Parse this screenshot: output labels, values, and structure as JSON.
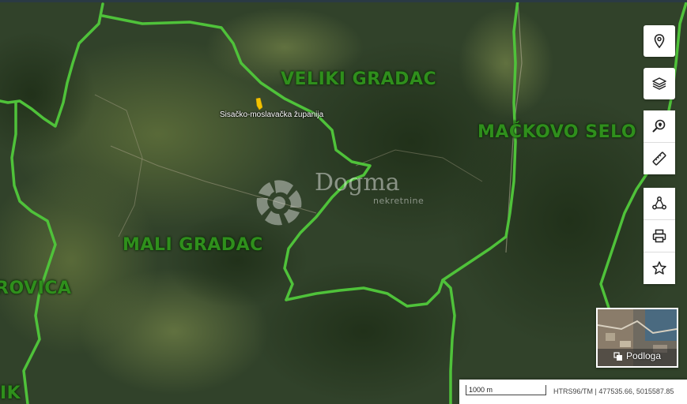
{
  "map": {
    "regions": [
      {
        "name": "VELIKI GRADAC"
      },
      {
        "name": "MAČKOVO SELO"
      },
      {
        "name": "MALI GRADAC"
      },
      {
        "name": "ROVICA"
      },
      {
        "name": "IK"
      }
    ],
    "county_label": "Sisačko-moslavačka županija",
    "watermark": {
      "brand": "Dogma",
      "tagline": "nekretnine"
    },
    "boundary_color": "#4fc23a",
    "parcel_color": "#f2c200"
  },
  "toolbar": {
    "buttons": [
      {
        "id": "location",
        "icon": "location-pin-icon"
      },
      {
        "id": "layers",
        "icon": "layers-icon"
      },
      {
        "id": "search-location",
        "icon": "search-location-icon"
      },
      {
        "id": "measure",
        "icon": "ruler-icon"
      },
      {
        "id": "share",
        "icon": "share-icon"
      },
      {
        "id": "print",
        "icon": "printer-icon"
      },
      {
        "id": "favorite",
        "icon": "star-icon"
      }
    ]
  },
  "basemap": {
    "label": "Podloga",
    "icon": "basemap-switch-icon"
  },
  "scale": {
    "label": "1000 m"
  },
  "coordinates": {
    "text": "HTRS96/TM | 477535.66, 5015587.85"
  }
}
